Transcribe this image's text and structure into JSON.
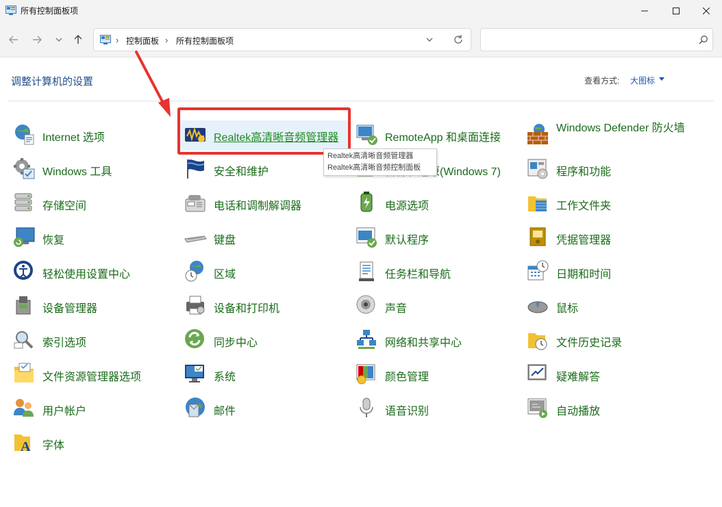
{
  "window": {
    "title": "所有控制面板项"
  },
  "nav": {
    "breadcrumbs": [
      "控制面板",
      "所有控制面板项"
    ],
    "search_placeholder": ""
  },
  "header": {
    "title": "调整计算机的设置",
    "view_by_label": "查看方式:",
    "view_by_value": "大图标"
  },
  "tooltip": {
    "line1": "Realtek高清晰音频管理器",
    "line2": "Realtek高清晰音频控制面板"
  },
  "accent": {
    "link_green": "#1a6b1a",
    "highlight_red": "#e8332f",
    "title_blue": "#1e4e8c"
  },
  "items": [
    {
      "label": "Internet 选项",
      "icon": "internet-options-icon"
    },
    {
      "label": "Realtek高清晰音频管理器",
      "icon": "realtek-audio-icon"
    },
    {
      "label": "RemoteApp 和桌面连接",
      "icon": "remoteapp-icon"
    },
    {
      "label": "Windows Defender 防火墙",
      "icon": "firewall-icon"
    },
    {
      "label": "Windows 工具",
      "icon": "windows-tools-icon"
    },
    {
      "label": "安全和维护",
      "icon": "security-flag-icon"
    },
    {
      "label": "备份和还原(Windows 7)",
      "icon": "backup-icon"
    },
    {
      "label": "程序和功能",
      "icon": "programs-icon"
    },
    {
      "label": "存储空间",
      "icon": "storage-icon"
    },
    {
      "label": "电话和调制解调器",
      "icon": "phone-modem-icon"
    },
    {
      "label": "电源选项",
      "icon": "power-icon"
    },
    {
      "label": "工作文件夹",
      "icon": "work-folders-icon"
    },
    {
      "label": "恢复",
      "icon": "recovery-icon"
    },
    {
      "label": "键盘",
      "icon": "keyboard-icon"
    },
    {
      "label": "默认程序",
      "icon": "default-programs-icon"
    },
    {
      "label": "凭据管理器",
      "icon": "credential-icon"
    },
    {
      "label": "轻松使用设置中心",
      "icon": "ease-of-access-icon"
    },
    {
      "label": "区域",
      "icon": "region-icon"
    },
    {
      "label": "任务栏和导航",
      "icon": "taskbar-icon"
    },
    {
      "label": "日期和时间",
      "icon": "datetime-icon"
    },
    {
      "label": "设备管理器",
      "icon": "device-manager-icon"
    },
    {
      "label": "设备和打印机",
      "icon": "printer-icon"
    },
    {
      "label": "声音",
      "icon": "sound-icon"
    },
    {
      "label": "鼠标",
      "icon": "mouse-icon"
    },
    {
      "label": "索引选项",
      "icon": "indexing-icon"
    },
    {
      "label": "同步中心",
      "icon": "sync-icon"
    },
    {
      "label": "网络和共享中心",
      "icon": "network-icon"
    },
    {
      "label": "文件历史记录",
      "icon": "file-history-icon"
    },
    {
      "label": "文件资源管理器选项",
      "icon": "folder-options-icon"
    },
    {
      "label": "系统",
      "icon": "system-icon"
    },
    {
      "label": "颜色管理",
      "icon": "color-management-icon"
    },
    {
      "label": "疑难解答",
      "icon": "troubleshoot-icon"
    },
    {
      "label": "用户帐户",
      "icon": "user-accounts-icon"
    },
    {
      "label": "邮件",
      "icon": "mail-icon"
    },
    {
      "label": "语音识别",
      "icon": "microphone-icon"
    },
    {
      "label": "自动播放",
      "icon": "autoplay-icon"
    },
    {
      "label": "字体",
      "icon": "fonts-icon"
    }
  ]
}
